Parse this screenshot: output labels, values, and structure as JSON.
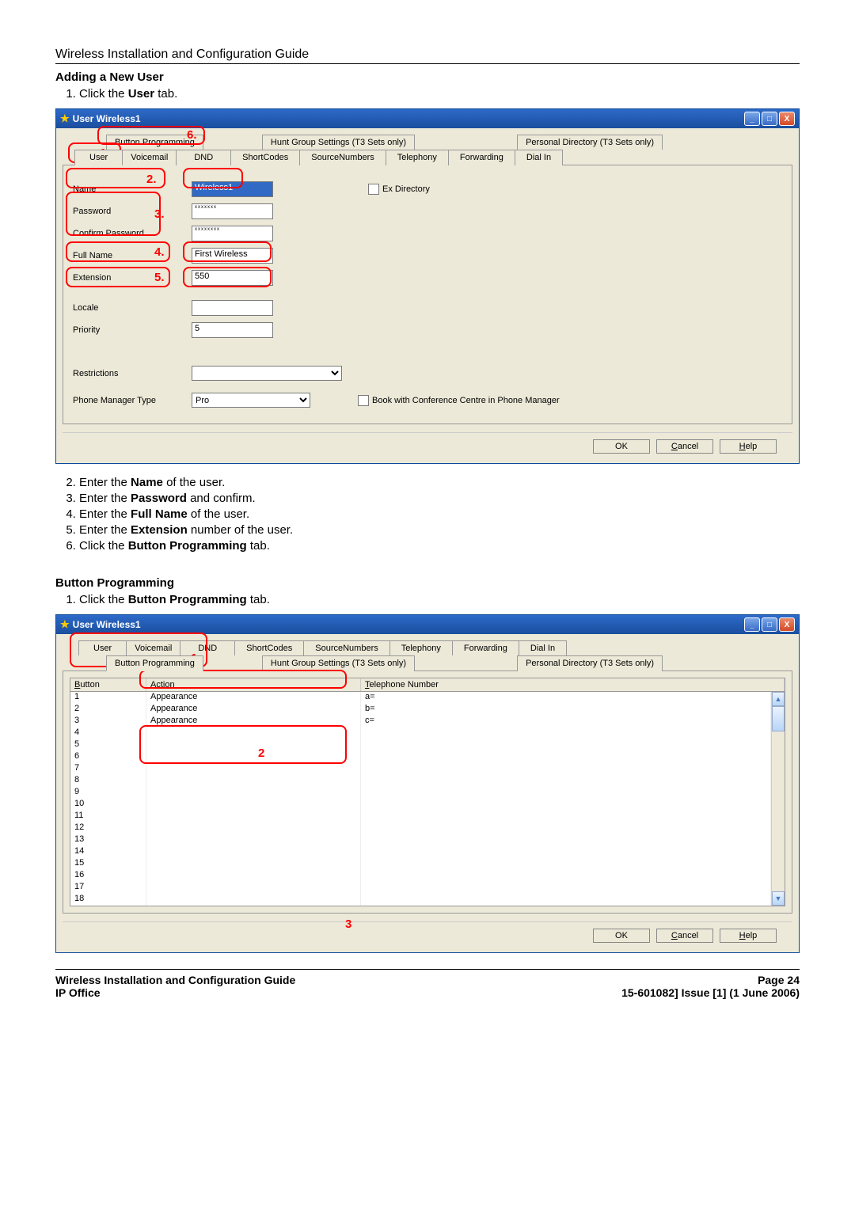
{
  "page_header": "Wireless Installation and Configuration Guide",
  "section1": {
    "title": "Adding a New User",
    "step1": "Click the ",
    "step1_bold": "User",
    "step1_end": " tab.",
    "step2": "Enter the ",
    "step2_bold": "Name",
    "step2_end": " of the user.",
    "step3": "Enter the ",
    "step3_bold": "Password",
    "step3_end": " and confirm.",
    "step4": "Enter the ",
    "step4_bold": "Full Name",
    "step4_end": " of the user.",
    "step5": "Enter the ",
    "step5_bold": "Extension",
    "step5_end": " number of the user.",
    "step6": "Click the ",
    "step6_bold": "Button Programming",
    "step6_end": " tab."
  },
  "section2": {
    "title": "Button Programming",
    "step1": "Click the ",
    "step1_bold": "Button Programming",
    "step1_end": " tab."
  },
  "window1": {
    "title": "User Wireless1",
    "tabs_row1": {
      "btn_prog": "Button Programming",
      "hunt": "Hunt Group Settings (T3 Sets only)",
      "pers": "Personal Directory (T3 Sets only)"
    },
    "tabs_row2": {
      "user": "User",
      "voicemail": "Voicemail",
      "dnd": "DND",
      "shortcodes": "ShortCodes",
      "sourcenumbers": "SourceNumbers",
      "telephony": "Telephony",
      "forwarding": "Forwarding",
      "dialin": "Dial In"
    },
    "fields": {
      "name": "Name",
      "name_val": "Wireless1",
      "ex_dir": "Ex Directory",
      "password": "Password",
      "password_val": "xxxxxxx",
      "confirm": "Confirm Password",
      "confirm_val": "xxxxxxxx",
      "fullname": "Full Name",
      "fullname_val": "First Wireless",
      "extension": "Extension",
      "extension_val": "550",
      "locale": "Locale",
      "locale_val": "",
      "priority": "Priority",
      "priority_val": "5",
      "restrictions": "Restrictions",
      "phone_mgr": "Phone Manager Type",
      "phone_mgr_val": "Pro",
      "book_conf": "Book with Conference Centre in Phone Manager"
    },
    "annotations": {
      "a1": "1.",
      "a2": "2.",
      "a3": "3.",
      "a4": "4.",
      "a5": "5.",
      "a6": "6."
    },
    "buttons": {
      "ok": "OK",
      "cancel": "Cancel",
      "help": "Help"
    }
  },
  "window2": {
    "title": "User Wireless1",
    "headers": {
      "button": "Button",
      "action": "Action",
      "telephone": "Telephone Number"
    },
    "rows": [
      {
        "n": "1",
        "a": "Appearance",
        "t": "a="
      },
      {
        "n": "2",
        "a": "Appearance",
        "t": "b="
      },
      {
        "n": "3",
        "a": "Appearance",
        "t": "c="
      },
      {
        "n": "4",
        "a": "",
        "t": ""
      },
      {
        "n": "5",
        "a": "",
        "t": ""
      },
      {
        "n": "6",
        "a": "",
        "t": ""
      },
      {
        "n": "7",
        "a": "",
        "t": ""
      },
      {
        "n": "8",
        "a": "",
        "t": ""
      },
      {
        "n": "9",
        "a": "",
        "t": ""
      },
      {
        "n": "10",
        "a": "",
        "t": ""
      },
      {
        "n": "11",
        "a": "",
        "t": ""
      },
      {
        "n": "12",
        "a": "",
        "t": ""
      },
      {
        "n": "13",
        "a": "",
        "t": ""
      },
      {
        "n": "14",
        "a": "",
        "t": ""
      },
      {
        "n": "15",
        "a": "",
        "t": ""
      },
      {
        "n": "16",
        "a": "",
        "t": ""
      },
      {
        "n": "17",
        "a": "",
        "t": ""
      },
      {
        "n": "18",
        "a": "",
        "t": ""
      }
    ],
    "annotations": {
      "a1": "1",
      "a2": "2",
      "a3": "3"
    }
  },
  "footer": {
    "left1": "Wireless Installation and Configuration Guide",
    "left2": "IP Office",
    "right1": "Page 24",
    "right2": "15-601082] Issue [1] (1 June 2006)"
  }
}
